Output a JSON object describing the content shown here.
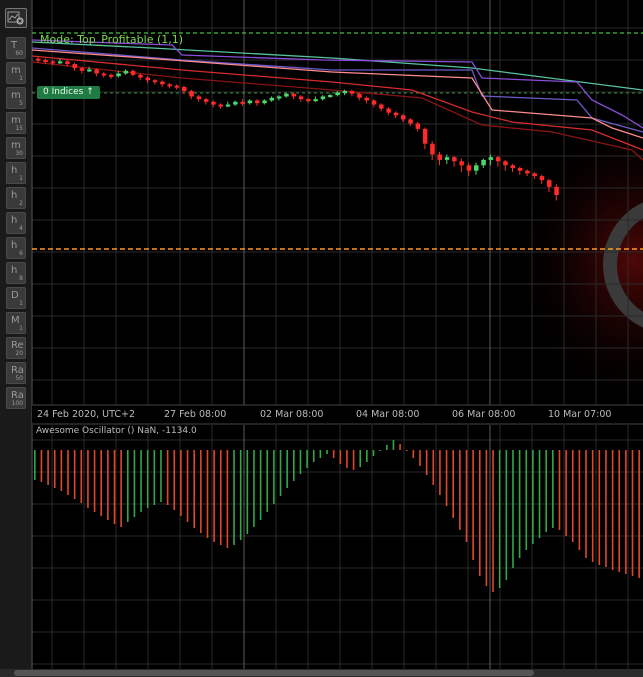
{
  "sidebar": {
    "settings_icon": "chart-settings-icon",
    "timeframes": [
      {
        "main": "T",
        "sub": "60"
      },
      {
        "main": "m",
        "sub": "1"
      },
      {
        "main": "m",
        "sub": "5"
      },
      {
        "main": "m",
        "sub": "15"
      },
      {
        "main": "m",
        "sub": "30"
      },
      {
        "main": "h",
        "sub": "1"
      },
      {
        "main": "h",
        "sub": "2"
      },
      {
        "main": "h",
        "sub": "4"
      },
      {
        "main": "h",
        "sub": "6"
      },
      {
        "main": "h",
        "sub": "8"
      },
      {
        "main": "D",
        "sub": "1"
      },
      {
        "main": "M",
        "sub": "1"
      },
      {
        "main": "Re",
        "sub": "20"
      },
      {
        "main": "Ra",
        "sub": "50"
      },
      {
        "main": "Ra",
        "sub": "100"
      }
    ]
  },
  "chart": {
    "mode_label": "Mode: Top_Profitable (1,1)",
    "indices_badge": "0 Indices ↑",
    "x_labels": [
      "24 Feb 2020, UTC+2",
      "27 Feb 08:00",
      "02 Mar 08:00",
      "04 Mar 08:00",
      "06 Mar 08:00",
      "10 Mar 07:00"
    ]
  },
  "oscillator": {
    "title": "Awesome Oscillator () NaN, -1134.0"
  },
  "colors": {
    "bull": "#4cd86a",
    "bear": "#ff2b2b",
    "ao_up": "#2fa84a",
    "ao_down": "#e0472a",
    "grid": "#2a2a2a",
    "dashed_green": "#3fbf3f",
    "dashed_orange": "#ff9a1f"
  },
  "chart_data": {
    "type": "bar",
    "candles": [
      [
        1,
        0,
        2,
        -2,
        3
      ],
      [
        0,
        -1,
        1,
        -3,
        2
      ],
      [
        -1,
        -2,
        0,
        -4,
        1
      ],
      [
        -2,
        -1,
        1,
        -3,
        0
      ],
      [
        -1,
        -3,
        0,
        -5,
        0
      ],
      [
        -3,
        -6,
        -2,
        -8,
        -3
      ],
      [
        -6,
        -8,
        -5,
        -10,
        -6
      ],
      [
        -8,
        -7,
        -5,
        -9,
        -7
      ],
      [
        -7,
        -10,
        -6,
        -12,
        -8
      ],
      [
        -10,
        -11,
        -9,
        -13,
        -9
      ],
      [
        -11,
        -12,
        -10,
        -14,
        -10
      ],
      [
        -12,
        -10,
        -8,
        -13,
        -9
      ],
      [
        -10,
        -8,
        -7,
        -11,
        -8
      ],
      [
        -8,
        -11,
        -7,
        -12,
        -9
      ],
      [
        -11,
        -13,
        -10,
        -15,
        -11
      ],
      [
        -13,
        -15,
        -12,
        -17,
        -13
      ],
      [
        -15,
        -16,
        -14,
        -18,
        -14
      ],
      [
        -16,
        -18,
        -15,
        -20,
        -16
      ],
      [
        -18,
        -19,
        -17,
        -21,
        -17
      ],
      [
        -19,
        -20,
        -18,
        -22,
        -18
      ],
      [
        -20,
        -23,
        -19,
        -25,
        -21
      ],
      [
        -23,
        -27,
        -22,
        -29,
        -24
      ],
      [
        -27,
        -29,
        -26,
        -31,
        -27
      ],
      [
        -29,
        -31,
        -28,
        -33,
        -29
      ],
      [
        -31,
        -33,
        -30,
        -35,
        -31
      ],
      [
        -33,
        -34,
        -32,
        -36,
        -32
      ],
      [
        -34,
        -33,
        -31,
        -35,
        -32
      ],
      [
        -33,
        -31,
        -30,
        -34,
        -31
      ],
      [
        -31,
        -32,
        -29,
        -34,
        -31
      ],
      [
        -32,
        -30,
        -29,
        -33,
        -30
      ],
      [
        -30,
        -32,
        -29,
        -34,
        -31
      ],
      [
        -32,
        -30,
        -29,
        -33,
        -30
      ],
      [
        -30,
        -28,
        -27,
        -31,
        -28
      ],
      [
        -28,
        -27,
        -26,
        -30,
        -27
      ],
      [
        -27,
        -25,
        -24,
        -28,
        -25
      ],
      [
        -25,
        -27,
        -24,
        -29,
        -26
      ],
      [
        -27,
        -29,
        -26,
        -31,
        -28
      ],
      [
        -29,
        -30,
        -28,
        -32,
        -29
      ],
      [
        -30,
        -29,
        -27,
        -31,
        -28
      ],
      [
        -29,
        -27,
        -26,
        -30,
        -27
      ],
      [
        -27,
        -26,
        -25,
        -28,
        -26
      ],
      [
        -26,
        -24,
        -23,
        -27,
        -24
      ],
      [
        -24,
        -23,
        -22,
        -26,
        -23
      ],
      [
        -23,
        -25,
        -22,
        -27,
        -24
      ],
      [
        -25,
        -28,
        -24,
        -30,
        -26
      ],
      [
        -28,
        -30,
        -27,
        -32,
        -29
      ],
      [
        -30,
        -33,
        -29,
        -35,
        -31
      ],
      [
        -33,
        -36,
        -32,
        -38,
        -34
      ],
      [
        -36,
        -39,
        -35,
        -41,
        -37
      ],
      [
        -39,
        -41,
        -38,
        -43,
        -40
      ],
      [
        -41,
        -44,
        -40,
        -46,
        -42
      ],
      [
        -44,
        -47,
        -43,
        -49,
        -45
      ],
      [
        -47,
        -51,
        -46,
        -53,
        -49
      ],
      [
        -51,
        -62,
        -50,
        -66,
        -56
      ],
      [
        -62,
        -70,
        -60,
        -74,
        -66
      ],
      [
        -70,
        -74,
        -68,
        -78,
        -72
      ],
      [
        -74,
        -72,
        -70,
        -77,
        -72
      ],
      [
        -72,
        -75,
        -71,
        -79,
        -73
      ],
      [
        -75,
        -78,
        -73,
        -83,
        -76
      ],
      [
        -78,
        -82,
        -76,
        -86,
        -80
      ],
      [
        -82,
        -78,
        -76,
        -85,
        -79
      ],
      [
        -78,
        -74,
        -73,
        -80,
        -76
      ],
      [
        -74,
        -72,
        -70,
        -78,
        -73
      ],
      [
        -72,
        -75,
        -71,
        -79,
        -74
      ],
      [
        -75,
        -78,
        -74,
        -82,
        -76
      ],
      [
        -78,
        -80,
        -77,
        -83,
        -79
      ],
      [
        -80,
        -82,
        -79,
        -85,
        -81
      ],
      [
        -82,
        -84,
        -81,
        -86,
        -83
      ],
      [
        -84,
        -86,
        -83,
        -88,
        -85
      ],
      [
        -86,
        -89,
        -85,
        -92,
        -88
      ],
      [
        -89,
        -94,
        -88,
        -98,
        -92
      ],
      [
        -94,
        -100,
        -92,
        -104,
        -97
      ]
    ],
    "ao_values": [
      -30,
      -32,
      -35,
      -38,
      -41,
      -45,
      -49,
      -53,
      -58,
      -62,
      -66,
      -70,
      -74,
      -77,
      -72,
      -67,
      -62,
      -58,
      -55,
      -52,
      -55,
      -60,
      -66,
      -72,
      -78,
      -83,
      -88,
      -92,
      -95,
      -98,
      -95,
      -90,
      -84,
      -77,
      -70,
      -62,
      -54,
      -46,
      -38,
      -31,
      -24,
      -18,
      -12,
      -8,
      -4,
      -8,
      -14,
      -18,
      -20,
      -17,
      -12,
      -6,
      0,
      5,
      10,
      6,
      0,
      -8,
      -16,
      -25,
      -35,
      -45,
      -56,
      -68,
      -80,
      -92,
      -110,
      -126,
      -136,
      -142,
      -138,
      -130,
      -118,
      -108,
      -100,
      -94,
      -88,
      -82,
      -78,
      -80,
      -86,
      -92,
      -100,
      -108,
      -112,
      -115,
      -117,
      -120,
      -122,
      -124,
      -126,
      -128
    ]
  }
}
